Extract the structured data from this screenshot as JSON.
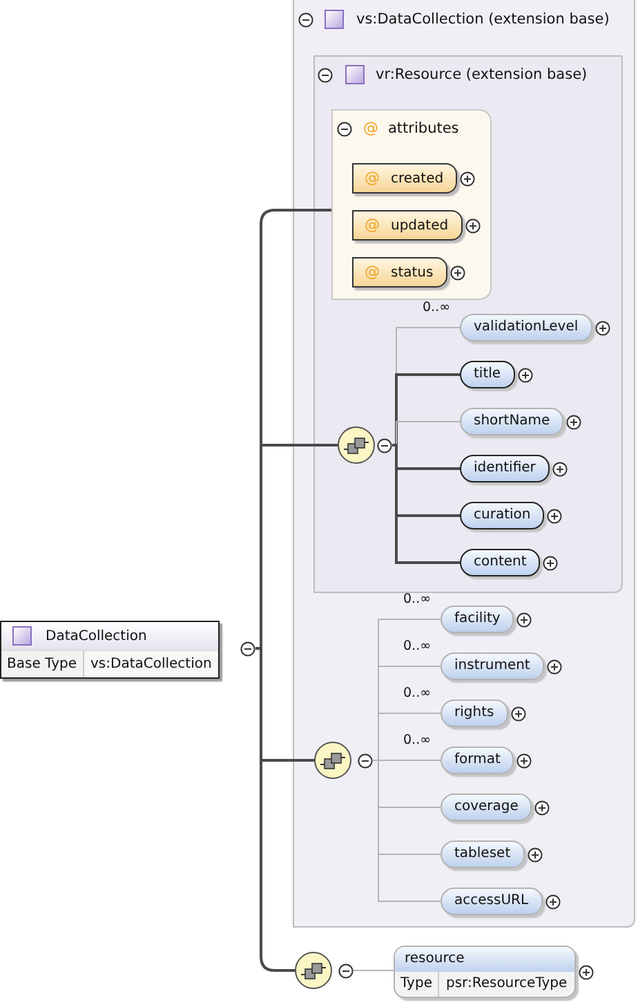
{
  "root": {
    "name": "DataCollection",
    "base_type_label": "Base Type",
    "base_type": "vs:DataCollection",
    "expanded": true
  },
  "extension": {
    "title": "vs:DataCollection (extension base)",
    "expanded": true,
    "inner_extension": {
      "title": "vr:Resource (extension base)",
      "expanded": true,
      "attributes": {
        "marker": "@",
        "title": "attributes",
        "expanded": true,
        "items": [
          {
            "marker": "@",
            "name": "created",
            "expanded": false
          },
          {
            "marker": "@",
            "name": "updated",
            "expanded": false
          },
          {
            "marker": "@",
            "name": "status",
            "expanded": false
          }
        ]
      },
      "sequence": {
        "expanded": true,
        "elements": [
          {
            "name": "validationLevel",
            "occurs": "0..∞",
            "optional": true,
            "expanded": false
          },
          {
            "name": "title",
            "optional": false,
            "expanded": false
          },
          {
            "name": "shortName",
            "optional": true,
            "expanded": false
          },
          {
            "name": "identifier",
            "optional": false,
            "expanded": false
          },
          {
            "name": "curation",
            "optional": false,
            "expanded": false
          },
          {
            "name": "content",
            "optional": false,
            "expanded": false
          }
        ]
      }
    },
    "sequence": {
      "expanded": true,
      "elements": [
        {
          "name": "facility",
          "occurs": "0..∞",
          "optional": true,
          "expanded": false
        },
        {
          "name": "instrument",
          "occurs": "0..∞",
          "optional": true,
          "expanded": false
        },
        {
          "name": "rights",
          "occurs": "0..∞",
          "optional": true,
          "expanded": false
        },
        {
          "name": "format",
          "occurs": "0..∞",
          "optional": true,
          "expanded": false
        },
        {
          "name": "coverage",
          "optional": true,
          "expanded": false
        },
        {
          "name": "tableset",
          "optional": true,
          "expanded": false
        },
        {
          "name": "accessURL",
          "optional": true,
          "expanded": false
        }
      ]
    }
  },
  "sequence": {
    "expanded": true,
    "element": {
      "name": "resource",
      "type_label": "Type",
      "type": "psr:ResourceType",
      "optional": true,
      "expanded": false
    }
  }
}
